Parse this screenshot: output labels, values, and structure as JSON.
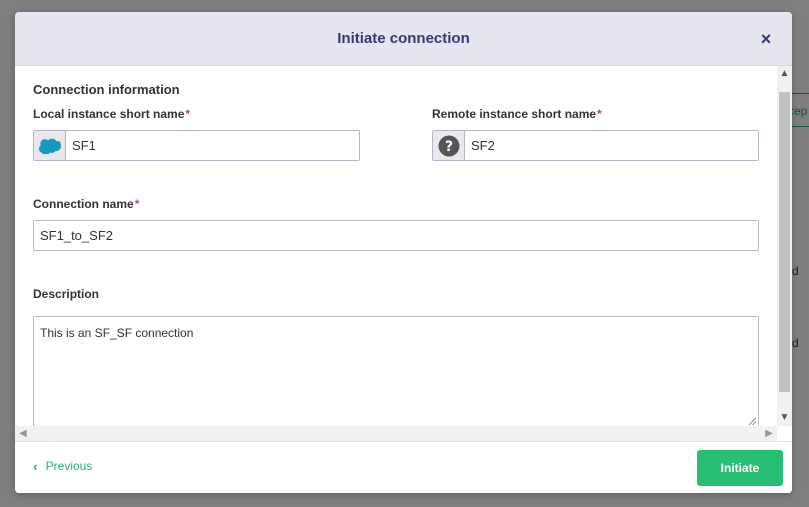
{
  "background": {
    "partial_button_text": "cep",
    "partial_text_1": "d",
    "partial_text_2": "d"
  },
  "modal": {
    "title": "Initiate connection",
    "close_symbol": "×",
    "section_title": "Connection information",
    "local": {
      "label": "Local instance short name",
      "value": "SF1",
      "icon": "salesforce-cloud-icon"
    },
    "remote": {
      "label": "Remote instance short name",
      "value": "SF2",
      "icon": "question-circle-icon"
    },
    "connection_name": {
      "label": "Connection name",
      "value": "SF1_to_SF2"
    },
    "description": {
      "label": "Description",
      "value": "This is an SF_SF connection"
    },
    "required_marker": "*",
    "footer": {
      "previous_label": "Previous",
      "initiate_label": "Initiate"
    }
  },
  "colors": {
    "title": "#3b3577",
    "accent_green": "#26bf74",
    "required": "#d14242",
    "salesforce_blue": "#1798c1"
  }
}
